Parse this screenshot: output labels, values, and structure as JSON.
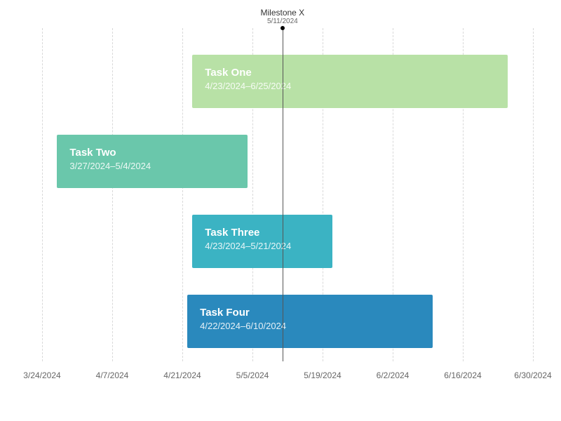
{
  "chart_data": {
    "type": "gantt",
    "x_axis": {
      "min": "3/24/2024",
      "max": "6/30/2024",
      "ticks": [
        "3/24/2024",
        "4/7/2024",
        "4/21/2024",
        "5/5/2024",
        "5/19/2024",
        "6/2/2024",
        "6/16/2024",
        "6/30/2024"
      ]
    },
    "milestones": [
      {
        "name": "Milestone X",
        "date": "5/11/2024"
      }
    ],
    "tasks": [
      {
        "name": "Task One",
        "start": "4/23/2024",
        "end": "6/25/2024",
        "date_label": "4/23/2024–6/25/2024",
        "color": "#b8e1a6"
      },
      {
        "name": "Task Two",
        "start": "3/27/2024",
        "end": "5/4/2024",
        "date_label": "3/27/2024–5/4/2024",
        "color": "#6ac7ab"
      },
      {
        "name": "Task Three",
        "start": "4/23/2024",
        "end": "5/21/2024",
        "date_label": "4/23/2024–5/21/2024",
        "color": "#3bb3c3"
      },
      {
        "name": "Task Four",
        "start": "4/22/2024",
        "end": "6/10/2024",
        "date_label": "4/22/2024–6/10/2024",
        "color": "#2a89bd"
      }
    ]
  }
}
